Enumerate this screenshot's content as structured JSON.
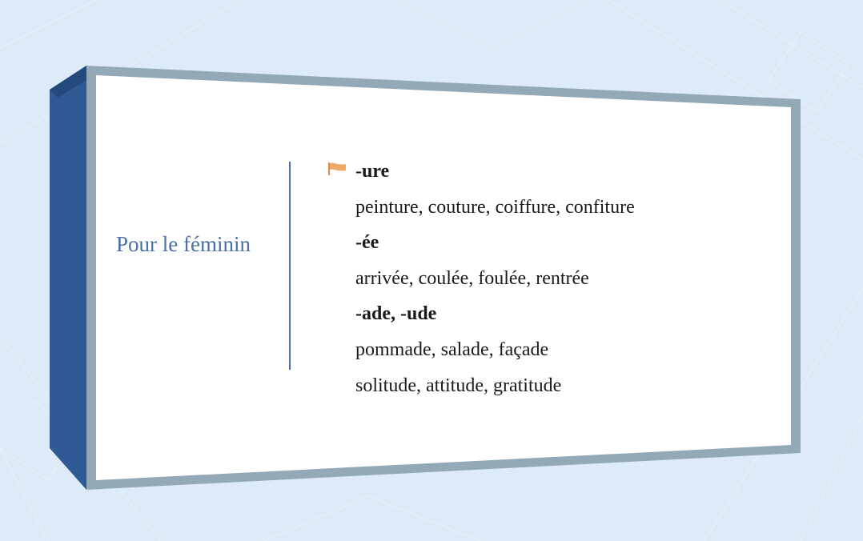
{
  "slide": {
    "section_label": "Pour le féminin",
    "entries": [
      {
        "kind": "suffix",
        "text": "-ure"
      },
      {
        "kind": "examples",
        "text": "peinture, couture, coiffure, confiture"
      },
      {
        "kind": "suffix",
        "text": "-ée"
      },
      {
        "kind": "examples",
        "text": "arrivée, coulée, foulée, rentrée"
      },
      {
        "kind": "suffix",
        "text": "-ade, -ude"
      },
      {
        "kind": "examples",
        "text": "pommade, salade, façade"
      },
      {
        "kind": "examples",
        "text": "solitude, attitude, gratitude"
      }
    ]
  },
  "colors": {
    "background": "#dcebf7",
    "frame_border": "#94a9b8",
    "frame_side": "#2f5a96",
    "label": "#4a6fa5",
    "divider": "#4f6fae",
    "flag": "#f0a868"
  },
  "icons": {
    "bullet": "flag-icon"
  }
}
